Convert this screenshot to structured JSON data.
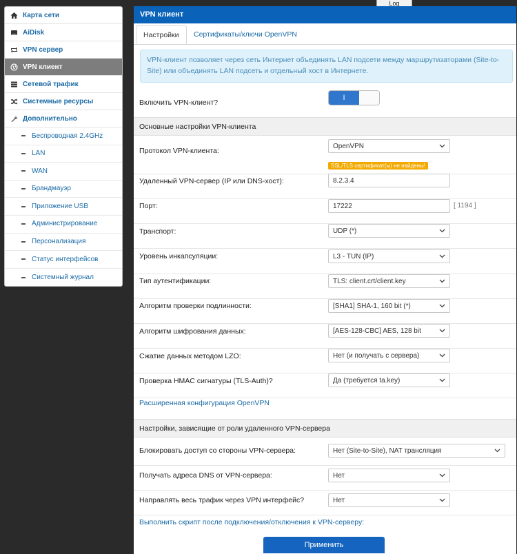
{
  "log_tab": "Log",
  "sidebar": {
    "items": [
      {
        "label": "Карта сети",
        "icon": "home-icon"
      },
      {
        "label": "AiDisk",
        "icon": "disk-icon"
      },
      {
        "label": "VPN сервер",
        "icon": "swap-icon"
      },
      {
        "label": "VPN клиент",
        "icon": "globe-icon"
      },
      {
        "label": "Сетевой трафик",
        "icon": "list-icon"
      },
      {
        "label": "Системные ресурсы",
        "icon": "shuffle-icon"
      },
      {
        "label": "Дополнительно",
        "icon": "wrench-icon"
      }
    ],
    "subitems": [
      "Беспроводная 2.4GHz",
      "LAN",
      "WAN",
      "Брандмауэр",
      "Приложение USB",
      "Администрирование",
      "Персонализация",
      "Статус интерфейсов",
      "Системный журнал"
    ]
  },
  "panel": {
    "title": "VPN клиент",
    "tabs": [
      "Настройки",
      "Сертификаты/ключи OpenVPN"
    ],
    "info": "VPN-клиент позволяет через сеть Интернет объединять LAN подсети между маршрутизаторами (Site-to-Site) или объединять LAN подсеть и отдельный хост в Интернете.",
    "enable_label": "Включить VPN-клиент?",
    "enable_on": "I",
    "section1": "Основные настройки VPN-клиента",
    "protocol_label": "Протокол VPN-клиента:",
    "protocol_value": "OpenVPN",
    "cert_warning": "SSL/TLS сертификат(ы) не найдены!",
    "server_label": "Удаленный VPN-сервер (IP или DNS-хост):",
    "server_value": "8.2.3.4",
    "port_label": "Порт:",
    "port_value": "17222",
    "port_hint": "[ 1194 ]",
    "transport_label": "Транспорт:",
    "transport_value": "UDP (*)",
    "encap_label": "Уровень инкапсуляции:",
    "encap_value": "L3 - TUN (IP)",
    "auth_label": "Тип аутентификации:",
    "auth_value": "TLS: client.crt/client.key",
    "hash_label": "Алгоритм проверки подлинности:",
    "hash_value": "[SHA1] SHA-1, 160 bit (*)",
    "cipher_label": "Алгоритм шифрования данных:",
    "cipher_value": "[AES-128-CBC] AES, 128 bit",
    "lzo_label": "Сжатие данных методом LZO:",
    "lzo_value": "Нет (и получать с сервера)",
    "hmac_label": "Проверка HMAC сигнатуры (TLS-Auth)?",
    "hmac_value": "Да (требуется ta.key)",
    "advanced_link": "Расширенная конфигурация OpenVPN",
    "section2": "Настройки, зависящие от роли удаленного VPN-сервера",
    "block_label": "Блокировать доступ со стороны VPN-сервера:",
    "block_value": "Нет (Site-to-Site), NAT трансляция",
    "dns_label": "Получать адреса DNS от VPN-сервера:",
    "dns_value": "Нет",
    "route_label": "Направлять весь трафик через VPN интерфейс?",
    "route_value": "Нет",
    "script_link": "Выполнить скрипт после подключения/отключения к VPN-серверу:",
    "apply": "Применить"
  }
}
